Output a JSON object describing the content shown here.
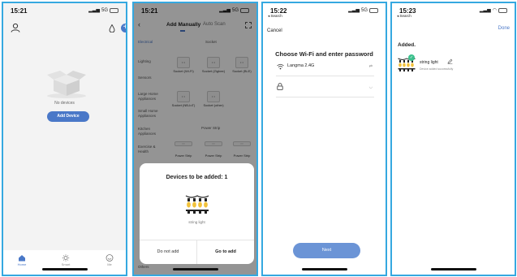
{
  "screen1": {
    "time": "15:21",
    "network": "5G",
    "no_devices_text": "No devices",
    "add_device_label": "Add Device",
    "tabs": [
      {
        "label": "Home",
        "active": true
      },
      {
        "label": "Smart",
        "active": false
      },
      {
        "label": "Me",
        "active": false
      }
    ]
  },
  "screen2": {
    "time": "15:21",
    "network": "5G",
    "tab_manual": "Add Manually",
    "tab_auto": "Auto Scan",
    "categories": [
      "Electrical",
      "Lighting",
      "Sensors",
      "Large Home Appliances",
      "Small Home Appliances",
      "Kitchen Appliances",
      "Exercise & Health"
    ],
    "others_label": "Others",
    "section_socket": "Socket",
    "section_power_strip": "Power Strip",
    "sockets_row1": [
      "Socket (Wi-Fi)",
      "Socket (Zigbee)",
      "Socket (BLE)"
    ],
    "sockets_row2": [
      "Socket (NB-IoT)",
      "Socket (other)"
    ],
    "strips": [
      "Power Strip",
      "Power Strip",
      "Power Strip"
    ],
    "dialog": {
      "title": "Devices to be added: 1",
      "device_name": "string light",
      "do_not_add": "Do not add",
      "go_to_add": "Go to add"
    }
  },
  "screen3": {
    "time": "15:22",
    "network": "5G",
    "back_label": "◂ Search",
    "cancel": "Cancel",
    "title": "Choose Wi-Fi and enter password",
    "ssid": "Langma 2.4G",
    "next": "Next"
  },
  "screen4": {
    "time": "15:23",
    "back_label": "◂ Search",
    "done": "Done",
    "added": "Added.",
    "device_name": "string light",
    "status": "Device added successfully"
  },
  "colors": {
    "frame": "#35a8e0",
    "accent": "#4a78c8",
    "next_button": "#6b94d6",
    "success": "#3cc08d"
  }
}
